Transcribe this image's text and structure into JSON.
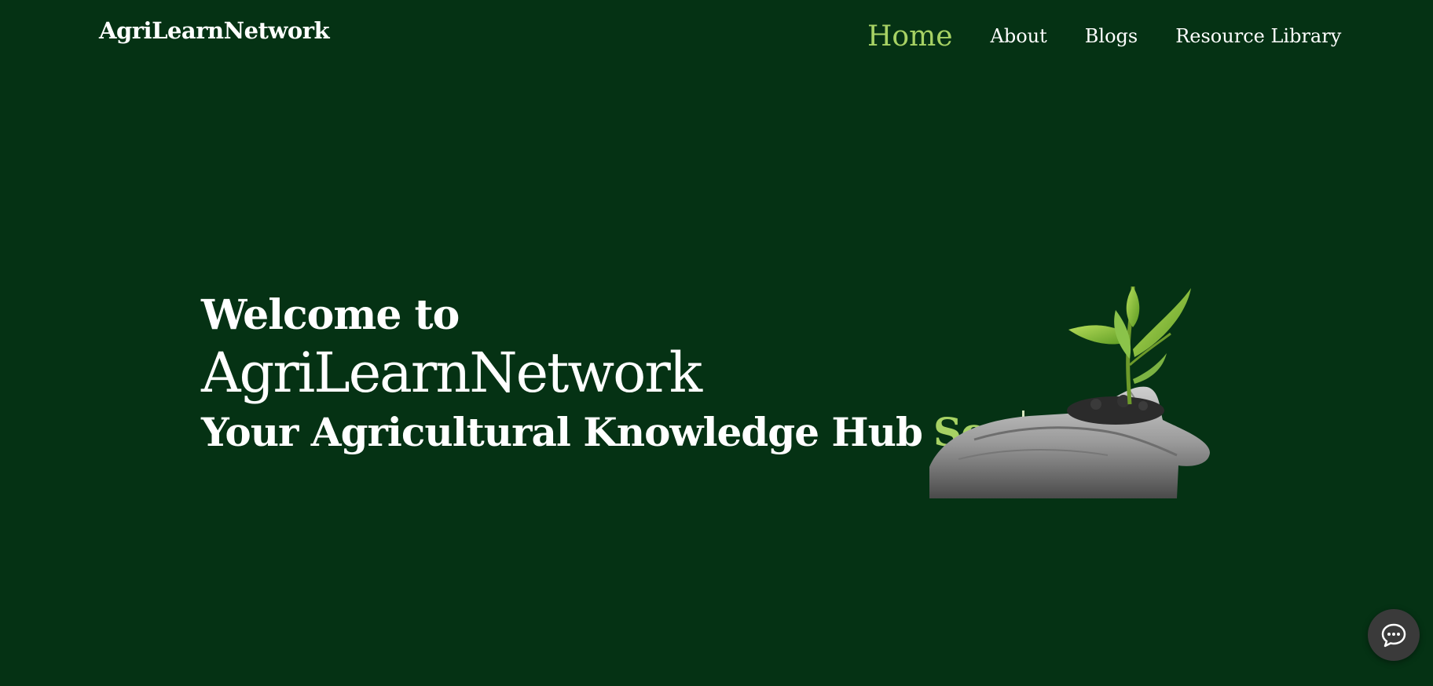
{
  "header": {
    "brand": "AgriLearnNetwork",
    "nav": [
      {
        "label": "Home",
        "active": true
      },
      {
        "label": "About",
        "active": false
      },
      {
        "label": "Blogs",
        "active": false
      },
      {
        "label": "Resource Library",
        "active": false
      }
    ]
  },
  "hero": {
    "line1": "Welcome to",
    "line2": "AgriLearnNetwork",
    "line3": "Your Agricultural Knowledge Hub",
    "typed_word": "Sow"
  },
  "illustration": {
    "icon": "seedling-in-hands-icon"
  },
  "chat": {
    "icon": "chat-bubble-icon"
  },
  "colors": {
    "background": "#053214",
    "accent": "#a7d264",
    "text": "#ffffff",
    "chat_button": "#3a3a3a"
  }
}
